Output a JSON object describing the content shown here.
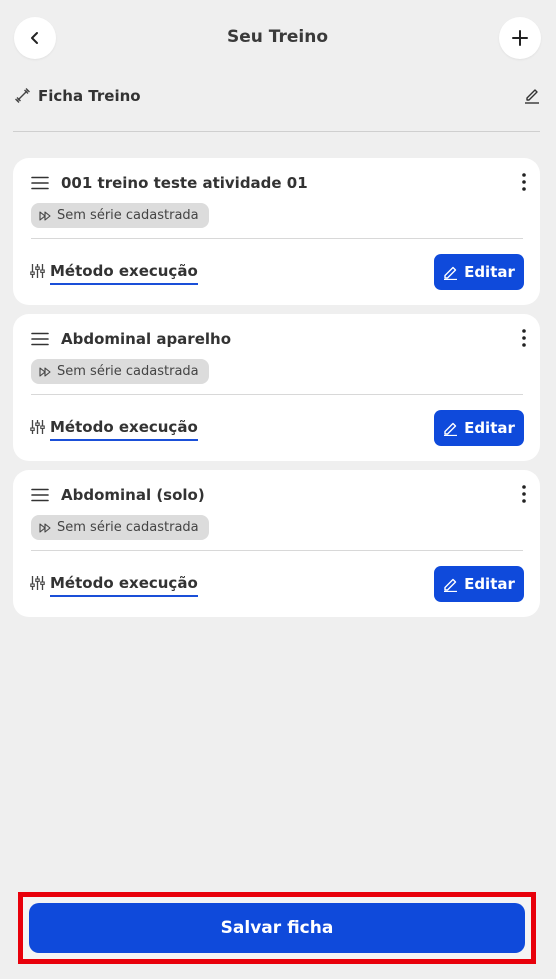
{
  "header": {
    "title": "Seu Treino",
    "back_icon": "chevron-left-icon",
    "add_icon": "plus-icon"
  },
  "ficha": {
    "label": "Ficha Treino",
    "icon": "dumbbell-icon",
    "edit_icon": "pencil-underline-icon"
  },
  "exercises": [
    {
      "title": "001 treino teste atividade 01",
      "badge": "Sem série cadastrada",
      "method": "Método execução",
      "edit_label": "Editar"
    },
    {
      "title": "Abdominal aparelho",
      "badge": "Sem série cadastrada",
      "method": "Método execução",
      "edit_label": "Editar"
    },
    {
      "title": "Abdominal (solo)",
      "badge": "Sem série cadastrada",
      "method": "Método execução",
      "edit_label": "Editar"
    }
  ],
  "footer": {
    "save_label": "Salvar ficha"
  },
  "colors": {
    "accent": "#0f4adb",
    "highlight": "#e8000b",
    "background": "#efefef"
  }
}
